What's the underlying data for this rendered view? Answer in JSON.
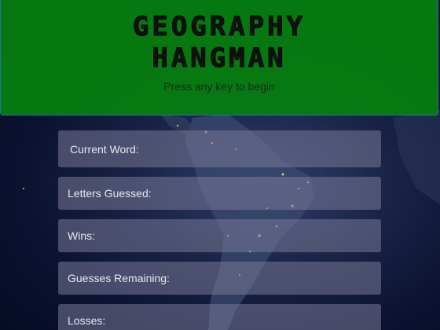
{
  "header": {
    "title_line1": "GEOGRAPHY",
    "title_line2": "HANGMAN",
    "subtitle": "Press any key to begin"
  },
  "panels": {
    "current_word": "Current Word:",
    "letters_guessed": "Letters Guessed:",
    "wins": "Wins:",
    "guesses_remaining": "Guesses Remaining:",
    "losses": "Losses:"
  },
  "colors": {
    "header_green": "#06800e",
    "panel_bg": "#78789a",
    "city_lights": "#f3e27a"
  }
}
